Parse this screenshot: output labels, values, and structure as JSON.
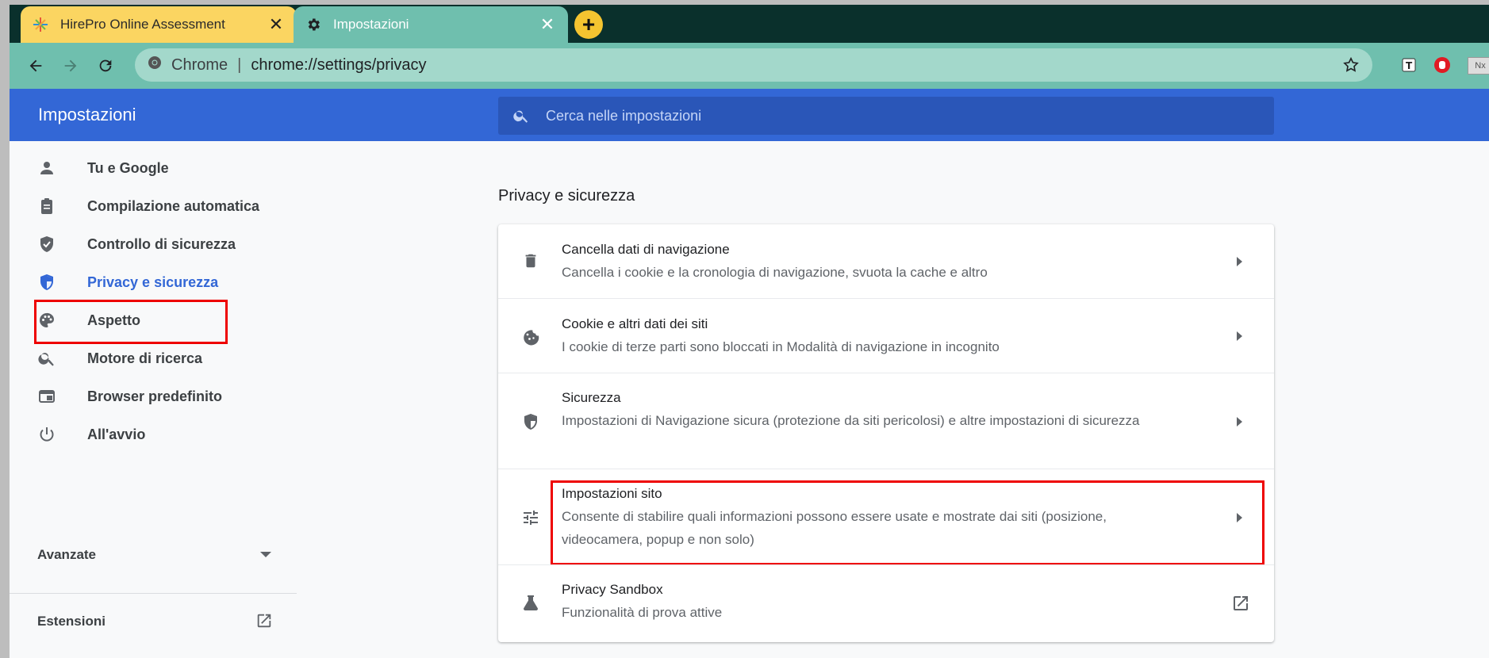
{
  "browser": {
    "tabs": [
      {
        "title": "HirePro Online Assessment",
        "icon": "hirepro-star-icon",
        "close": "✕"
      },
      {
        "title": "Impostazioni",
        "icon": "gear-icon",
        "close": "✕"
      }
    ],
    "new_tab": "+",
    "omnibox": {
      "site_label": "Chrome",
      "separator": "|",
      "url": "chrome://settings/privacy"
    },
    "ext_badge_nx": "Nx"
  },
  "header": {
    "title": "Impostazioni",
    "search_placeholder": "Cerca nelle impostazioni"
  },
  "sidebar": {
    "items": [
      {
        "label": "Tu e Google",
        "icon": "person-icon"
      },
      {
        "label": "Compilazione automatica",
        "icon": "clipboard-icon"
      },
      {
        "label": "Controllo di sicurezza",
        "icon": "shield-check-icon"
      },
      {
        "label": "Privacy e sicurezza",
        "icon": "shield-half-icon"
      },
      {
        "label": "Aspetto",
        "icon": "palette-icon"
      },
      {
        "label": "Motore di ricerca",
        "icon": "search-icon"
      },
      {
        "label": "Browser predefinito",
        "icon": "browser-window-icon"
      },
      {
        "label": "All'avvio",
        "icon": "power-icon"
      }
    ],
    "active_index": 3,
    "advanced": "Avanzate",
    "extensions": "Estensioni"
  },
  "main": {
    "section_title": "Privacy e sicurezza",
    "rows": [
      {
        "title": "Cancella dati di navigazione",
        "subtitle": "Cancella i cookie e la cronologia di navigazione, svuota la cache e altro",
        "icon": "trash-icon"
      },
      {
        "title": "Cookie e altri dati dei siti",
        "subtitle": "I cookie di terze parti sono bloccati in Modalità di navigazione in incognito",
        "icon": "cookie-icon"
      },
      {
        "title": "Sicurezza",
        "subtitle": "Impostazioni di Navigazione sicura (protezione da siti pericolosi) e altre impostazioni di sicurezza",
        "icon": "shield-icon"
      },
      {
        "title": "Impostazioni sito",
        "subtitle": "Consente di stabilire quali informazioni possono essere usate e mostrate dai siti (posizione, videocamera, popup e non solo)",
        "icon": "tune-icon"
      },
      {
        "title": "Privacy Sandbox",
        "subtitle": "Funzionalità di prova attive",
        "icon": "flask-icon"
      }
    ]
  },
  "colors": {
    "header_blue": "#3367d6",
    "highlight_red": "#e00000",
    "tab_yellow": "#fbd561",
    "tab_teal": "#6fbfae"
  }
}
